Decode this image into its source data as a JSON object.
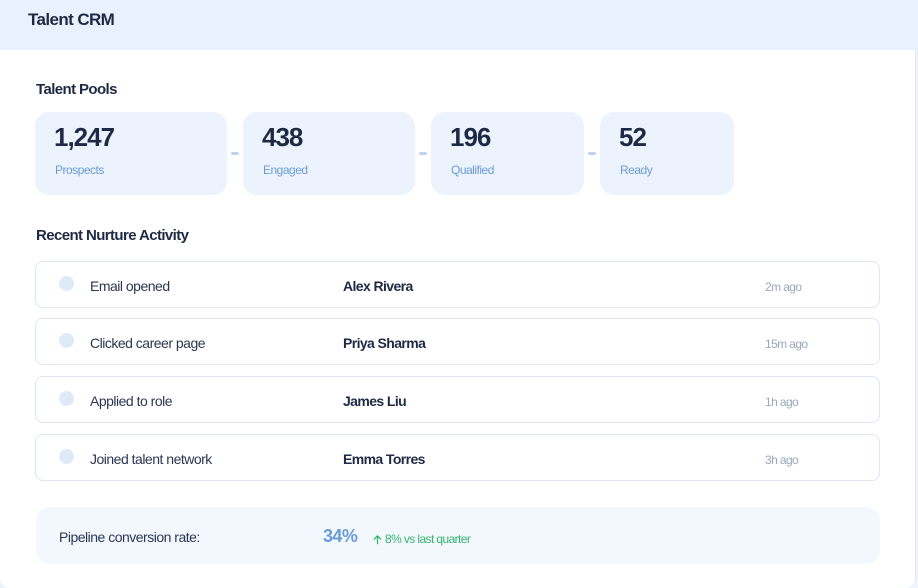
{
  "app": {
    "title": "Talent CRM"
  },
  "pools": {
    "title": "Talent Pools",
    "items": [
      {
        "value": "1,247",
        "label": "Prospects"
      },
      {
        "value": "438",
        "label": "Engaged"
      },
      {
        "value": "196",
        "label": "Qualified"
      },
      {
        "value": "52",
        "label": "Ready"
      }
    ]
  },
  "activity": {
    "title": "Recent Nurture Activity",
    "items": [
      {
        "action": "Email opened",
        "name": "Alex Rivera",
        "time": "2m ago"
      },
      {
        "action": "Clicked career page",
        "name": "Priya Sharma",
        "time": "15m ago"
      },
      {
        "action": "Applied to role",
        "name": "James Liu",
        "time": "1h ago"
      },
      {
        "action": "Joined talent network",
        "name": "Emma Torres",
        "time": "3h ago"
      }
    ]
  },
  "conversion": {
    "label": "Pipeline conversion rate:",
    "value": "34%",
    "delta": "8% vs last quarter",
    "delta_icon": "arrow-up-icon",
    "delta_color": "#34b36b"
  }
}
